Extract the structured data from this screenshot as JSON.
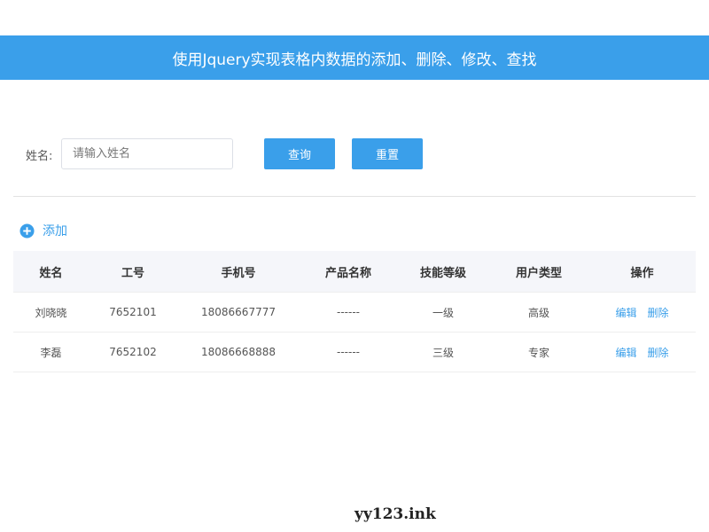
{
  "header": {
    "title": "使用Jquery实现表格内数据的添加、删除、修改、查找"
  },
  "search": {
    "label": "姓名:",
    "placeholder": "请输入姓名",
    "value": "",
    "query_label": "查询",
    "reset_label": "重置"
  },
  "add": {
    "label": "添加",
    "icon": "plus-circle-icon"
  },
  "table": {
    "columns": [
      "姓名",
      "工号",
      "手机号",
      "产品名称",
      "技能等级",
      "用户类型",
      "操作"
    ],
    "rows": [
      {
        "name": "刘晓晓",
        "id": "7652101",
        "phone": "18086667777",
        "product": "------",
        "level": "一级",
        "type": "高级",
        "edit": "编辑",
        "delete": "删除"
      },
      {
        "name": "李磊",
        "id": "7652102",
        "phone": "18086668888",
        "product": "------",
        "level": "三级",
        "type": "专家",
        "edit": "编辑",
        "delete": "删除"
      }
    ]
  },
  "watermark": "yy123.ink",
  "colors": {
    "accent": "#3a9fea",
    "header_bg": "#f5f6fa"
  }
}
